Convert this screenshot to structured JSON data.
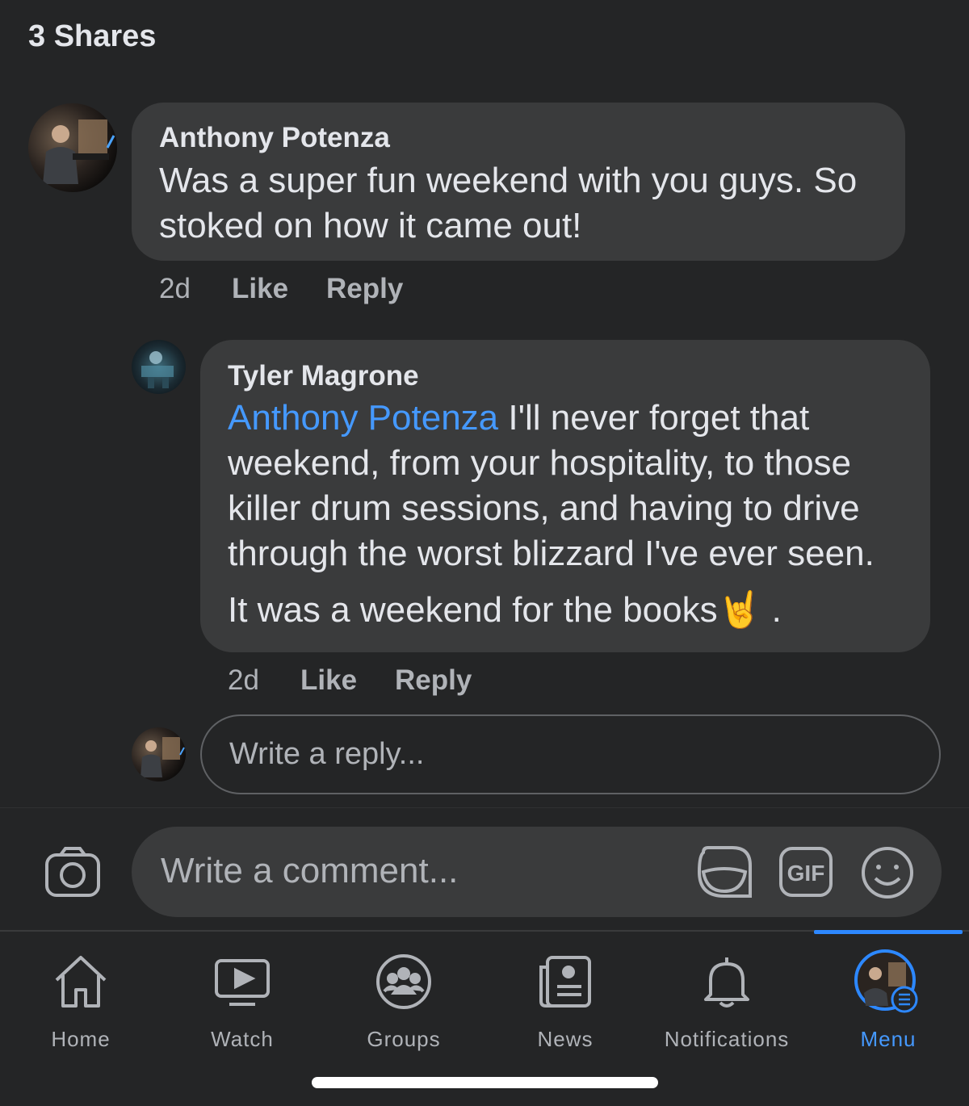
{
  "header": {
    "shares_label": "3 Shares"
  },
  "comments": [
    {
      "author": "Anthony Potenza",
      "text_line1": "Was a super fun weekend with you guys. So",
      "text_line2": "stoked on how it came out!",
      "time": "2d",
      "like": "Like",
      "reply": "Reply"
    },
    {
      "author": "Tyler Magrone",
      "mention": "Anthony Potenza",
      "text_line1": " I'll never forget that",
      "text_line2": "weekend, from your hospitality, to those",
      "text_line3": "killer drum sessions, and having to drive",
      "text_line4": "through the worst blizzard I've ever seen.",
      "text_line5": "It was a weekend for the books",
      "emoji": "🤘",
      "text_end": ".",
      "time": "2d",
      "like": "Like",
      "reply": "Reply"
    }
  ],
  "reply_box": {
    "placeholder": "Write a reply..."
  },
  "composer": {
    "placeholder": "Write a comment..."
  },
  "tabs": [
    {
      "label": "Home",
      "icon": "home-icon"
    },
    {
      "label": "Watch",
      "icon": "watch-icon"
    },
    {
      "label": "Groups",
      "icon": "groups-icon"
    },
    {
      "label": "News",
      "icon": "news-icon"
    },
    {
      "label": "Notifications",
      "icon": "bell-icon"
    },
    {
      "label": "Menu",
      "icon": "menu-icon",
      "active": true
    }
  ],
  "colors": {
    "background": "#242526",
    "bubble": "#3a3b3c",
    "accent": "#4599ff"
  }
}
